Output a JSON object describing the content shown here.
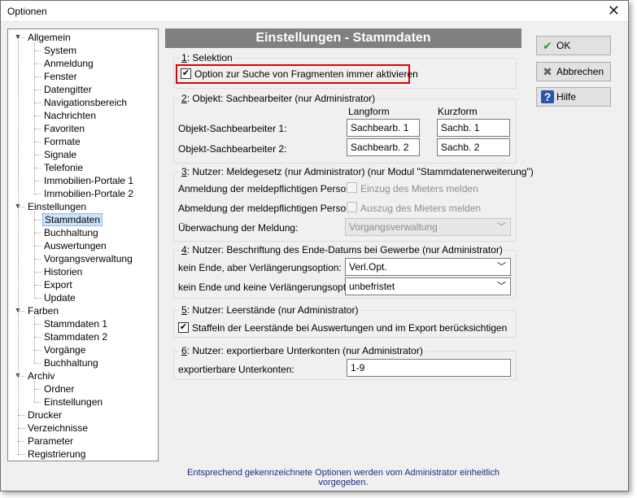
{
  "window": {
    "title": "Optionen",
    "close_glyph": "✕"
  },
  "tree": [
    {
      "label": "Allgemein",
      "level": 0,
      "expanded": true
    },
    {
      "label": "System",
      "level": 1
    },
    {
      "label": "Anmeldung",
      "level": 1
    },
    {
      "label": "Fenster",
      "level": 1
    },
    {
      "label": "Datengitter",
      "level": 1
    },
    {
      "label": "Navigationsbereich",
      "level": 1
    },
    {
      "label": "Nachrichten",
      "level": 1
    },
    {
      "label": "Favoriten",
      "level": 1
    },
    {
      "label": "Formate",
      "level": 1
    },
    {
      "label": "Signale",
      "level": 1
    },
    {
      "label": "Telefonie",
      "level": 1
    },
    {
      "label": "Immobilien-Portale 1",
      "level": 1
    },
    {
      "label": "Immobilien-Portale 2",
      "level": 1
    },
    {
      "label": "Einstellungen",
      "level": 0,
      "expanded": true
    },
    {
      "label": "Stammdaten",
      "level": 1,
      "selected": true
    },
    {
      "label": "Buchhaltung",
      "level": 1
    },
    {
      "label": "Auswertungen",
      "level": 1
    },
    {
      "label": "Vorgangsverwaltung",
      "level": 1
    },
    {
      "label": "Historien",
      "level": 1
    },
    {
      "label": "Export",
      "level": 1
    },
    {
      "label": "Update",
      "level": 1
    },
    {
      "label": "Farben",
      "level": 0,
      "expanded": true
    },
    {
      "label": "Stammdaten 1",
      "level": 1
    },
    {
      "label": "Stammdaten 2",
      "level": 1
    },
    {
      "label": "Vorgänge",
      "level": 1
    },
    {
      "label": "Buchhaltung",
      "level": 1
    },
    {
      "label": "Archiv",
      "level": 0,
      "expanded": true
    },
    {
      "label": "Ordner",
      "level": 1
    },
    {
      "label": "Einstellungen",
      "level": 1
    },
    {
      "label": "Drucker",
      "level": 0
    },
    {
      "label": "Verzeichnisse",
      "level": 0
    },
    {
      "label": "Parameter",
      "level": 0
    },
    {
      "label": "Registrierung",
      "level": 0
    }
  ],
  "panel": {
    "header": "Einstellungen - Stammdaten",
    "g1": {
      "num": "1",
      "title": ": Selektion",
      "checkbox_label": "Option zur Suche von Fragmenten immer aktivieren",
      "checked_glyph": "✔"
    },
    "g2": {
      "num": "2",
      "title": ": Objekt: Sachbearbeiter  (nur Administrator)",
      "col_long": "Langform",
      "col_short": "Kurzform",
      "row1_label": "Objekt-Sachbearbeiter 1:",
      "row1_long": "Sachbearb. 1",
      "row1_short": "Sachb. 1",
      "row2_label": "Objekt-Sachbearbeiter 2:",
      "row2_long": "Sachbearb. 2",
      "row2_short": "Sachb. 2"
    },
    "g3": {
      "num": "3",
      "title": ": Nutzer: Meldegesetz  (nur Administrator)  (nur Modul \"Stammdatenerweiterung\")",
      "row1_label": "Anmeldung der meldepflichtigen Person:",
      "row1_check": "Einzug des Mieters melden",
      "row2_label": "Abmeldung der meldepflichtigen Person:",
      "row2_check": "Auszug des Mieters melden",
      "row3_label": "Überwachung der Meldung:",
      "row3_value": "Vorgangsverwaltung"
    },
    "g4": {
      "num": "4",
      "title": ": Nutzer: Beschriftung des Ende-Datums bei Gewerbe  (nur Administrator)",
      "row1_label": "kein Ende, aber Verlängerungsoption:",
      "row1_value": "Verl.Opt.",
      "row2_label": "kein Ende und keine Verlängerungsoption:",
      "row2_value": "unbefristet"
    },
    "g5": {
      "num": "5",
      "title": ": Nutzer: Leerstände  (nur Administrator)",
      "checkbox_label": "Staffeln der Leerstände bei Auswertungen und im Export berücksichtigen",
      "checked_glyph": "✔"
    },
    "g6": {
      "num": "6",
      "title": ": Nutzer: exportierbare Unterkonten  (nur Administrator)",
      "row1_label": "exportierbare Unterkonten:",
      "row1_value": "1-9"
    }
  },
  "buttons": {
    "ok": "OK",
    "cancel": "Abbrechen",
    "help": "Hilfe"
  },
  "icons": {
    "ok": "check-icon",
    "cancel": "cross-icon",
    "help": "help-icon",
    "combo": "chevron-down-icon"
  },
  "footnote": "Entsprechend gekennzeichnete Optionen werden vom Administrator einheitlich vorgegeben.",
  "colors": {
    "header_bg": "#808080",
    "highlight": "#e00000",
    "footnote": "#1a2b8a",
    "selection": "#cce4f7"
  }
}
